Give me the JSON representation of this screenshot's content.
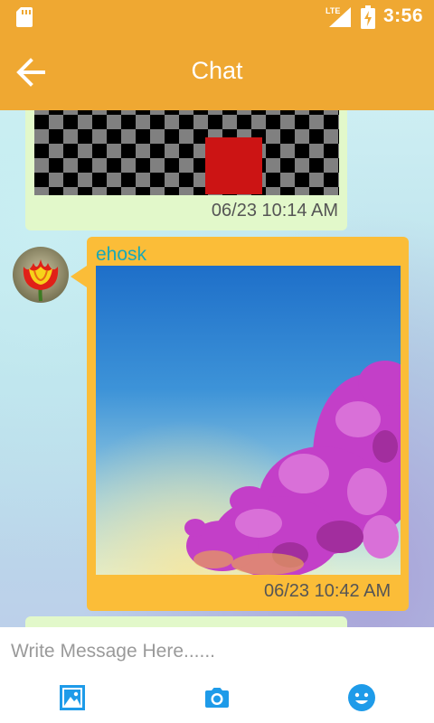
{
  "status_bar": {
    "network": "LTE",
    "time": "3:56"
  },
  "header": {
    "title": "Chat",
    "back_icon": "arrow-left-icon"
  },
  "messages": [
    {
      "type": "image",
      "timestamp": "06/23 10:14 AM"
    },
    {
      "type": "image",
      "sender": "ehosk",
      "timestamp": "06/23 10:42 AM"
    }
  ],
  "input": {
    "placeholder": "Write Message Here......",
    "value": ""
  },
  "toolbar": {
    "buttons": [
      "image-icon",
      "camera-icon",
      "smiley-icon"
    ]
  },
  "colors": {
    "primary": "#EFA832",
    "incoming_bubble": "#FBBD38",
    "outgoing_bubble": "#E2F8CA",
    "sender_name": "#18A8B8",
    "accent_icon": "#1E9BE9"
  }
}
